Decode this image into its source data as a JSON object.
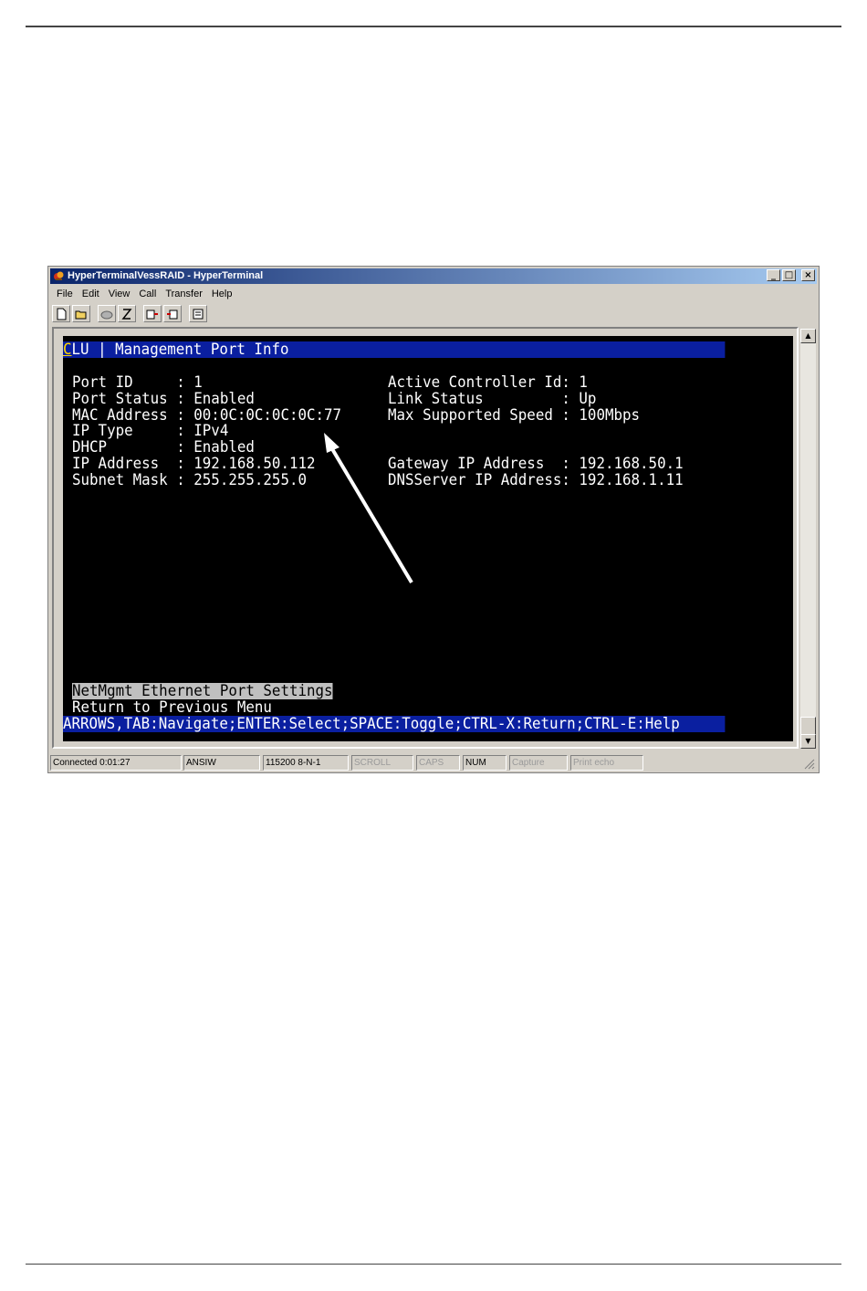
{
  "window": {
    "title": "HyperTerminalVessRAID - HyperTerminal",
    "minimize": "_",
    "maximize": "□",
    "close": "×"
  },
  "menu": [
    "File",
    "Edit",
    "View",
    "Call",
    "Transfer",
    "Help"
  ],
  "toolbar_icons": [
    "new-icon",
    "open-icon",
    "phone-icon",
    "disconnect-icon",
    "send-icon",
    "receive-icon",
    "properties-icon"
  ],
  "terminal": {
    "header_prefix": "C",
    "header_rest": "LU | Management Port Info",
    "left_rows": [
      "Port ID     : 1",
      "Port Status : Enabled",
      "MAC Address : 00:0C:0C:0C:0C:77",
      "IP Type     : IPv4",
      "DHCP        : Enabled",
      "IP Address  : 192.168.50.112",
      "Subnet Mask : 255.255.255.0"
    ],
    "right_rows": [
      "Active Controller Id: 1",
      "Link Status         : Up",
      "Max Supported Speed : 100Mbps",
      "",
      "",
      "Gateway IP Address  : 192.168.50.1",
      "DNSServer IP Address: 192.168.1.11"
    ],
    "menu_selected": "NetMgmt Ethernet Port Settings",
    "menu_item_2": "Return to Previous Menu",
    "footer": "ARROWS,TAB:Navigate;ENTER:Select;SPACE:Toggle;CTRL-X:Return;CTRL-E:Help"
  },
  "scrollbar": {
    "up": "▲",
    "down": "▼"
  },
  "status": {
    "connected": "Connected 0:01:27",
    "emulation": "ANSIW",
    "settings": "115200 8-N-1",
    "scroll": "SCROLL",
    "caps": "CAPS",
    "num": "NUM",
    "capture": "Capture",
    "print_echo": "Print echo"
  },
  "colors": {
    "terminal_bg": "#000000",
    "bar_bg": "#0a1fa0",
    "titlebar_start": "#0a246a",
    "titlebar_end": "#a6caf0",
    "chrome": "#d4d0c8"
  }
}
